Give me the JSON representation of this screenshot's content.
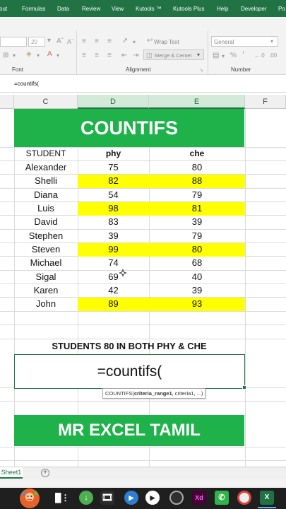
{
  "ribbon": {
    "tabs": [
      "out",
      "Formulas",
      "Data",
      "Review",
      "View",
      "Kutools ™",
      "Kutools Plus",
      "Help",
      "Developer",
      "Po"
    ],
    "font_size": "20",
    "wrap_text": "Wrap Text",
    "merge_center": "Merge & Center",
    "number_format": "General",
    "group_font": "Font",
    "group_alignment": "Alignment",
    "group_number": "Number"
  },
  "formula_bar": {
    "value": "=countifs("
  },
  "columns": [
    "C",
    "D",
    "E",
    "F"
  ],
  "selected_columns": [
    "D",
    "E"
  ],
  "sheet": {
    "title": "COUNTIFS",
    "headers": [
      "STUDENT",
      "phy",
      "che"
    ],
    "rows": [
      {
        "name": "Alexander",
        "phy": "75",
        "che": "80",
        "highlight": false
      },
      {
        "name": "Shelli",
        "phy": "82",
        "che": "88",
        "highlight": true
      },
      {
        "name": "Diana",
        "phy": "54",
        "che": "79",
        "highlight": false
      },
      {
        "name": "Luis",
        "phy": "98",
        "che": "81",
        "highlight": true
      },
      {
        "name": "David",
        "phy": "83",
        "che": "39",
        "highlight": false
      },
      {
        "name": "Stephen",
        "phy": "39",
        "che": "79",
        "highlight": false
      },
      {
        "name": "Steven",
        "phy": "99",
        "che": "80",
        "highlight": true
      },
      {
        "name": "Michael",
        "phy": "74",
        "che": "68",
        "highlight": false
      },
      {
        "name": "Sigal",
        "phy": "69",
        "che": "40",
        "highlight": false
      },
      {
        "name": "Karen",
        "phy": "42",
        "che": "39",
        "highlight": false
      },
      {
        "name": "John",
        "phy": "89",
        "che": "93",
        "highlight": true
      }
    ],
    "question": "STUDENTS 80 IN BOTH PHY & CHE",
    "formula_input": "=countifs(",
    "tooltip_func": "COUNTIFS(",
    "tooltip_arg1": "criteria_range1",
    "tooltip_rest": ", criteria1, ...)",
    "footer_banner": "MR EXCEL TAMIL"
  },
  "sheet_tabs": {
    "active": "Sheet1",
    "add": "+"
  },
  "colors": {
    "excel_green": "#217346",
    "banner_green": "#1fb14a",
    "highlight_yellow": "#ffff00"
  },
  "taskbar": {
    "icons": [
      "mascot-icon",
      "task-view-icon",
      "torrent-icon",
      "video-editor-icon",
      "media-player-icon",
      "obs-icon",
      "adobe-xd-icon",
      "phone-link-icon",
      "chrome-icon",
      "excel-icon"
    ]
  }
}
